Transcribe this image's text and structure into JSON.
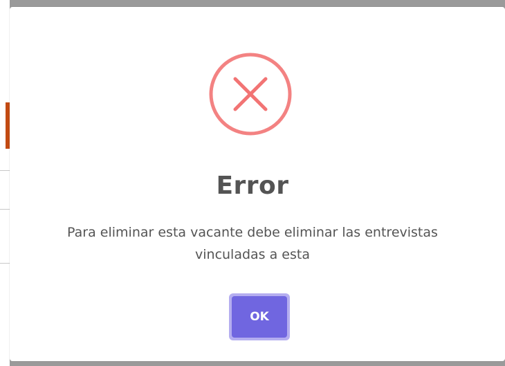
{
  "dialog": {
    "icon": "error-x-circle-icon",
    "title": "Error",
    "message_line1": "Para eliminar esta vacante debe eliminar las entrevistas",
    "message_line2": "vinculadas a esta",
    "ok_label": "OK"
  },
  "colors": {
    "error_icon": "#f27474",
    "button_bg": "#7066e0",
    "button_focus_ring": "#b5aef0",
    "text": "#545454",
    "overlay": "#9a9a9a",
    "background_accent": "#c24a12"
  }
}
